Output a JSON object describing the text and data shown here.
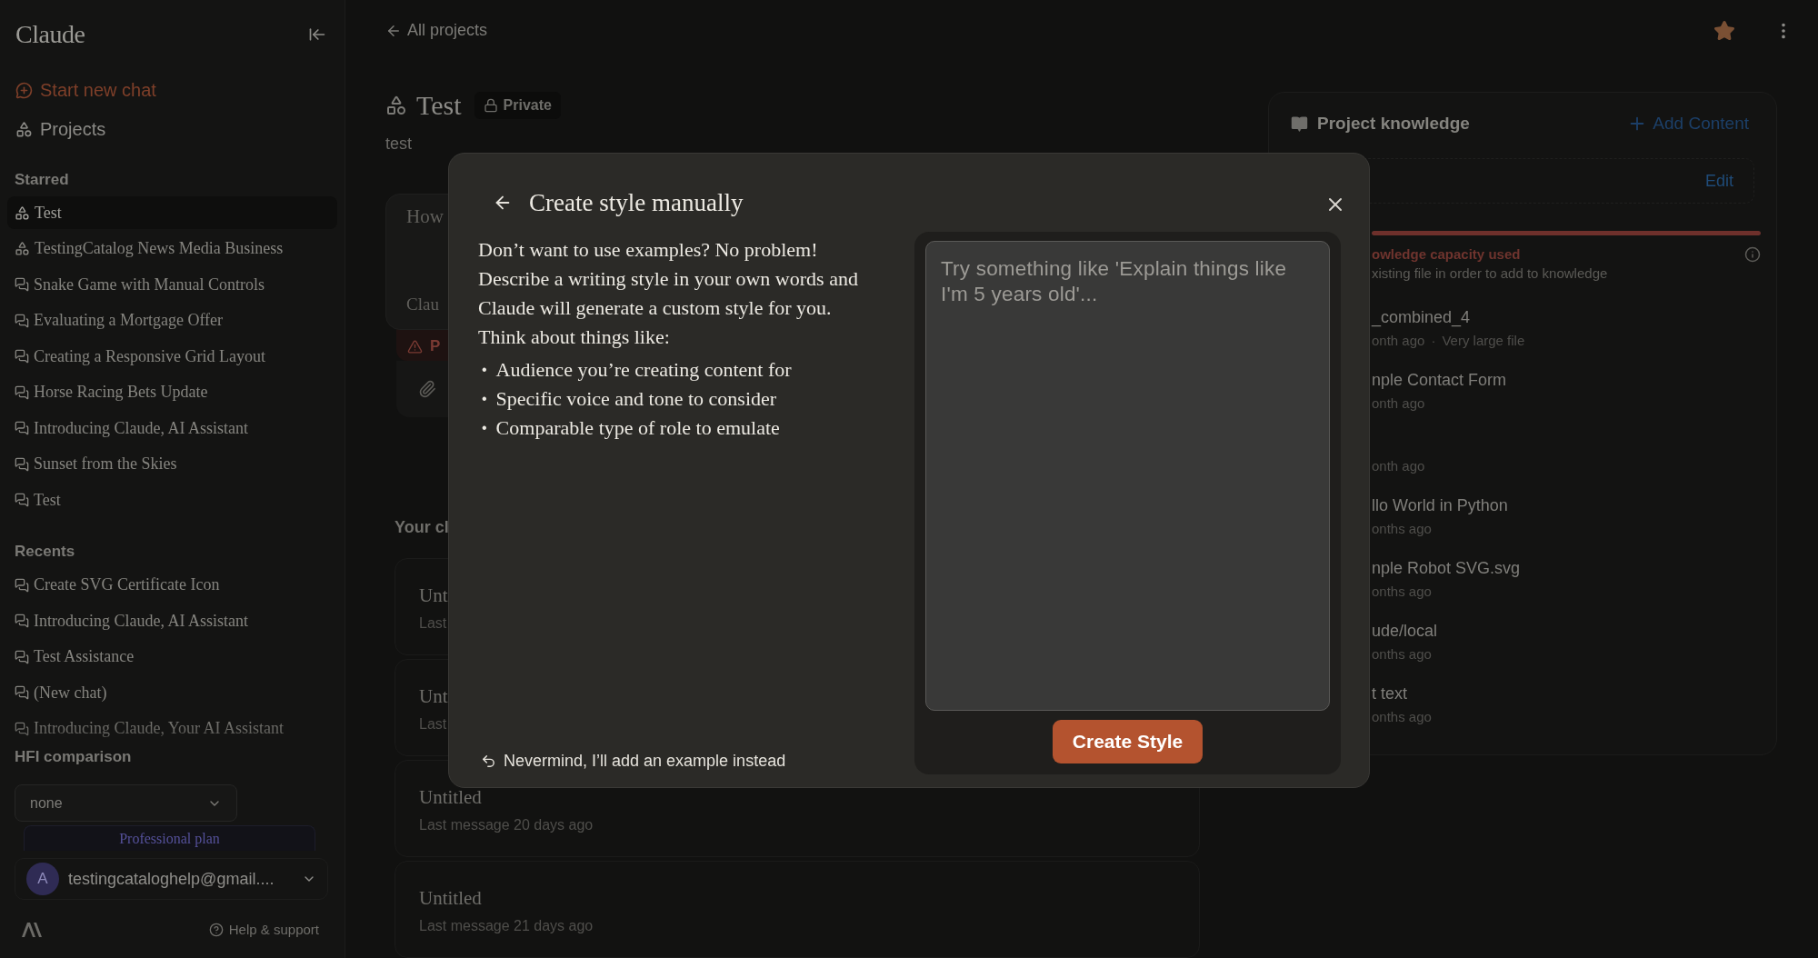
{
  "sidebar": {
    "logo": "Claude",
    "new_chat": "Start new chat",
    "projects": "Projects",
    "sections": [
      {
        "title": "Starred",
        "items": [
          {
            "label": "Test",
            "kind": "project",
            "selected": true
          },
          {
            "label": "TestingCatalog News Media Business",
            "kind": "project",
            "selected": false
          },
          {
            "label": "Snake Game with Manual Controls",
            "kind": "chat",
            "selected": false
          },
          {
            "label": "Evaluating a Mortgage Offer",
            "kind": "chat",
            "selected": false
          },
          {
            "label": "Creating a Responsive Grid Layout",
            "kind": "chat",
            "selected": false
          },
          {
            "label": "Horse Racing Bets Update",
            "kind": "chat",
            "selected": false
          },
          {
            "label": "Introducing Claude, AI Assistant",
            "kind": "chat",
            "selected": false
          },
          {
            "label": "Sunset from the Skies",
            "kind": "chat",
            "selected": false
          },
          {
            "label": "Test",
            "kind": "chat",
            "selected": false
          }
        ]
      },
      {
        "title": "Recents",
        "items": [
          {
            "label": "Create SVG Certificate Icon",
            "kind": "chat",
            "selected": false
          },
          {
            "label": "Introducing Claude, AI Assistant",
            "kind": "chat",
            "selected": false
          },
          {
            "label": "Test Assistance",
            "kind": "chat",
            "selected": false
          },
          {
            "label": "(New chat)",
            "kind": "chat",
            "selected": false
          },
          {
            "label": "Introducing Claude, Your AI Assistant",
            "kind": "chat",
            "selected": false
          }
        ]
      }
    ],
    "hfi": {
      "title": "HFI comparison",
      "select": "none",
      "plan": "Professional plan"
    },
    "account": {
      "avatar": "A",
      "email": "testingcataloghelp@gmail...."
    },
    "help": "Help & support"
  },
  "main": {
    "back": "All projects",
    "starred": true,
    "project": {
      "title": "Test",
      "badge": "Private",
      "description": "test"
    },
    "composer": {
      "placeholder": "How",
      "model": "Clau",
      "warning": "P"
    },
    "chats_heading": "Your cl",
    "chats": [
      {
        "title": "Unt",
        "meta": "Last"
      },
      {
        "title": "Unt",
        "meta": "Last"
      },
      {
        "title": "Untitled",
        "meta": "Last message 20 days ago"
      },
      {
        "title": "Untitled",
        "meta": "Last message 21 days ago"
      }
    ]
  },
  "knowledge": {
    "title": "Project knowledge",
    "add": "Add Content",
    "edit": "Edit",
    "capacity": {
      "level": 1,
      "label": "owledge capacity used",
      "hint": "xisting file in order to add to knowledge"
    },
    "files": [
      {
        "name": "_combined_4",
        "meta": "onth ago",
        "sep": "·",
        "note": "Very large file"
      },
      {
        "name": "nple Contact Form",
        "meta": "onth ago"
      },
      {
        "meta": "onth ago"
      },
      {
        "name": "llo World in Python",
        "meta": "onths ago"
      },
      {
        "name": "nple Robot SVG.svg",
        "meta": "onths ago"
      },
      {
        "name": "ude/local",
        "meta": "onths ago"
      },
      {
        "name": "t text",
        "meta": "onths ago"
      }
    ]
  },
  "dialog": {
    "title": "Create style manually",
    "intro": [
      "Don’t want to use examples? No problem!",
      "Describe a writing style in your own words and Claude will generate a custom style for you.",
      "Think about things like:"
    ],
    "bullet_mark": "•",
    "bullets": [
      "Audience you’re creating content for",
      "Specific voice and tone to consider",
      "Comparable type of role to emulate"
    ],
    "nevermind": "Nevermind, I’ll add an example instead",
    "placeholder": "Try something like 'Explain things like I'm 5 years old'...",
    "submit": "Create Style"
  }
}
